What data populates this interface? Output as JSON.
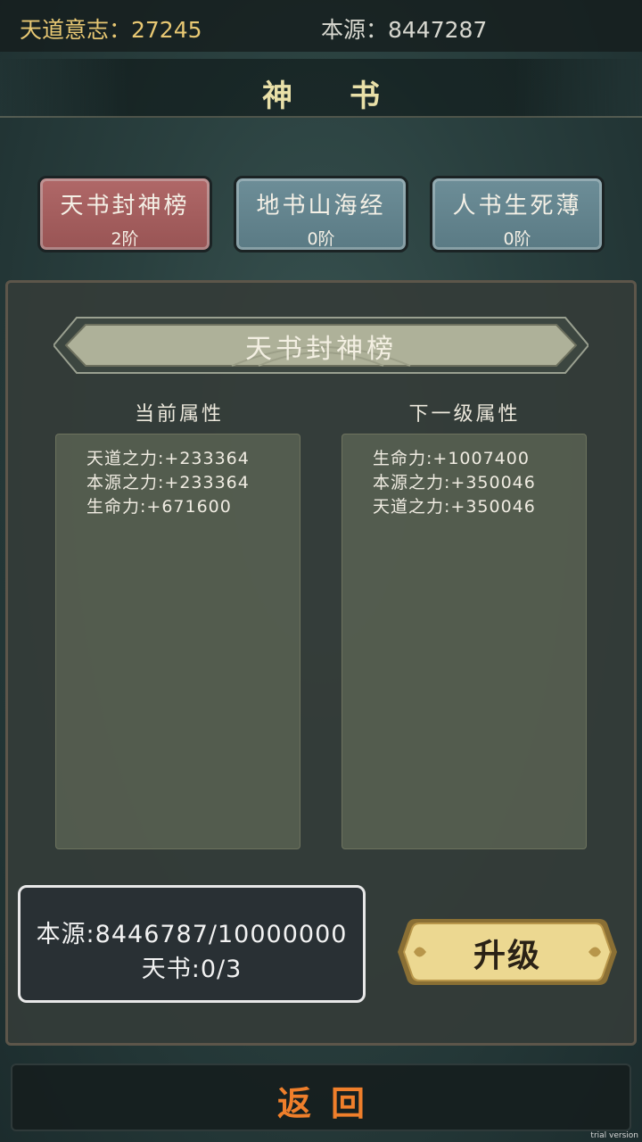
{
  "top_bar": {
    "tiandao_will": "天道意志：27245",
    "benyuan": "本源：8447287"
  },
  "page_title": "神书",
  "tabs": [
    {
      "label": "天书封神榜",
      "level": "2阶",
      "active": true
    },
    {
      "label": "地书山海经",
      "level": "0阶",
      "active": false
    },
    {
      "label": "人书生死薄",
      "level": "0阶",
      "active": false
    }
  ],
  "detail": {
    "book_title": "天书封神榜",
    "current_header": "当前属性",
    "next_header": "下一级属性",
    "current_attrs": [
      "天道之力:+233364",
      "本源之力:+233364",
      "生命力:+671600"
    ],
    "next_attrs": [
      "生命力:+1007400",
      "本源之力:+350046",
      "天道之力:+350046"
    ]
  },
  "requirements": {
    "benyuan": "本源:8446787/10000000",
    "tianshu": "天书:0/3"
  },
  "upgrade_label": "升级",
  "back_label": "返回",
  "watermark": "trial version",
  "colors": {
    "accent_gold": "#e8c873",
    "active_tab": "#b06868",
    "inactive_tab": "#6d8e98",
    "back_text": "#ef7f2b",
    "button_gold": "#e9d48a"
  }
}
